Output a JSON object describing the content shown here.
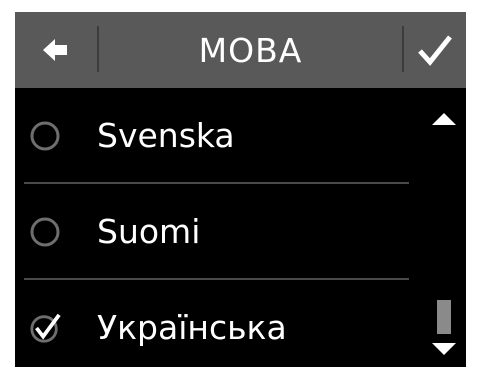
{
  "header": {
    "title": "МОВА",
    "back_icon": "arrow-left-icon",
    "confirm_icon": "checkmark-icon"
  },
  "languages": [
    {
      "label": "Svenska",
      "selected": false
    },
    {
      "label": "Suomi",
      "selected": false
    },
    {
      "label": "Українська",
      "selected": true
    }
  ],
  "scrollbar": {
    "up_icon": "triangle-up-icon",
    "down_icon": "triangle-down-icon"
  },
  "colors": {
    "header_bg": "#595959",
    "list_bg": "#000000",
    "text": "#ffffff",
    "radio_ring": "#6e6e6e"
  }
}
